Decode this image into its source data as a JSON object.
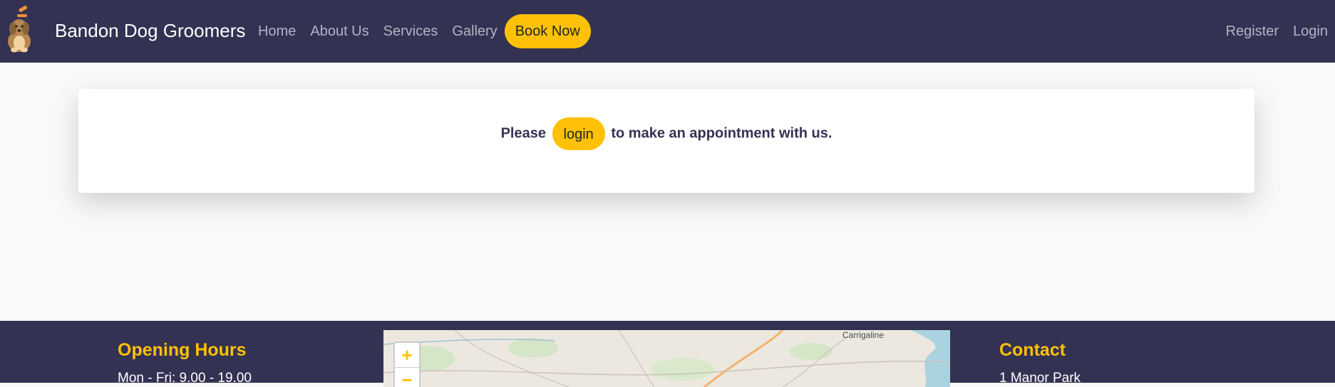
{
  "navbar": {
    "brand": "Bandon Dog Groomers",
    "links": [
      "Home",
      "About Us",
      "Services",
      "Gallery"
    ],
    "book_label": "Book Now",
    "right_links": [
      "Register",
      "Login"
    ]
  },
  "card": {
    "prefix": "Please",
    "login_label": "login",
    "suffix": "to make an appointment with us."
  },
  "footer": {
    "hours_heading": "Opening Hours",
    "hours_line1": "Mon - Fri: 9.00 - 19.00",
    "contact_heading": "Contact",
    "contact_line1": "1 Manor Park",
    "map": {
      "zoom_in": "+",
      "zoom_out": "−",
      "place_label": "Carrigaline"
    }
  },
  "colors": {
    "primary": "#343253",
    "accent": "#ffc107",
    "background": "#f9f9f9"
  }
}
